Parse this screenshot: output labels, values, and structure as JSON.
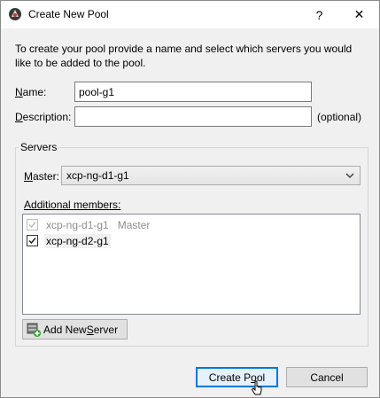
{
  "window": {
    "title": "Create New Pool",
    "help_label": "?",
    "close_label": "✕",
    "app_icon": "xencenter-pool-icon"
  },
  "intro_text": "To create your pool provide a name and select which servers you would like to be added to the pool.",
  "name": {
    "label_key": "N",
    "label_rest": "ame:",
    "value": "pool-g1"
  },
  "description": {
    "label_key": "D",
    "label_rest": "escription:",
    "value": "",
    "hint": "(optional)"
  },
  "servers_group": {
    "title": "Servers",
    "master_label_key": "M",
    "master_label_rest": "aster:",
    "master_value": "xcp-ng-d1-g1",
    "members_label_key": "A",
    "members_label_rest": "dditional members:",
    "members": [
      {
        "name": "xcp-ng-d1-g1",
        "note": "Master",
        "checked": true,
        "disabled": true
      },
      {
        "name": "xcp-ng-d2-g1",
        "note": "",
        "checked": true,
        "disabled": false
      }
    ],
    "add_server_pre": "Add New ",
    "add_server_key": "S",
    "add_server_post": "erver"
  },
  "buttons": {
    "create_pre": "Create P",
    "create_key": "o",
    "create_post": "ol",
    "cancel": "Cancel"
  },
  "colors": {
    "accent": "#0078d7",
    "disabled_text": "#8d8d8d"
  }
}
